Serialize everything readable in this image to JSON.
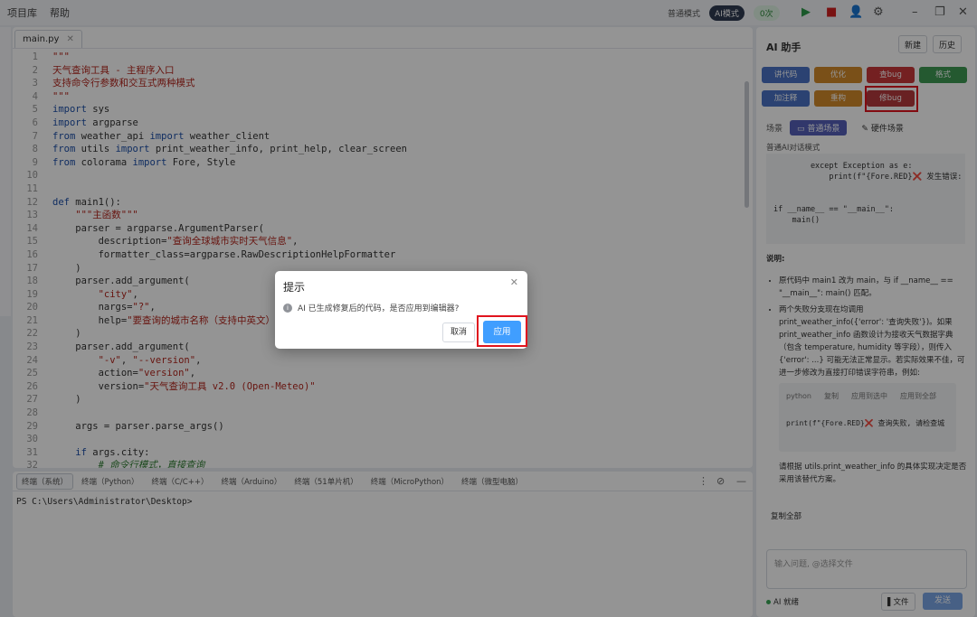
{
  "menu": [
    "项目库",
    "帮助"
  ],
  "toolbar": {
    "mode_normal": "普通模式",
    "mode_ai": "AI模式",
    "badge": "0次",
    "run_icon": "play-icon",
    "stop_icon": "stop-icon",
    "user_icon": "user-settings-icon",
    "settings_icon": "gear-icon"
  },
  "editor": {
    "file_tab": "main.py",
    "lines": [
      {
        "n": "1",
        "segs": [
          {
            "t": "\"\"\"",
            "c": "str"
          }
        ]
      },
      {
        "n": "2",
        "segs": [
          {
            "t": "天气查询工具 - 主程序入口",
            "c": "str"
          }
        ]
      },
      {
        "n": "3",
        "segs": [
          {
            "t": "支持命令行参数和交互式两种模式",
            "c": "str"
          }
        ]
      },
      {
        "n": "4",
        "segs": [
          {
            "t": "\"\"\"",
            "c": "str"
          }
        ]
      },
      {
        "n": "5",
        "segs": [
          {
            "t": "import",
            "c": "kw"
          },
          {
            "t": " sys",
            "c": ""
          }
        ]
      },
      {
        "n": "6",
        "segs": [
          {
            "t": "import",
            "c": "kw"
          },
          {
            "t": " argparse",
            "c": ""
          }
        ]
      },
      {
        "n": "7",
        "segs": [
          {
            "t": "from",
            "c": "kw"
          },
          {
            "t": " weather_api ",
            "c": ""
          },
          {
            "t": "import",
            "c": "kw"
          },
          {
            "t": " weather_client",
            "c": ""
          }
        ]
      },
      {
        "n": "8",
        "segs": [
          {
            "t": "from",
            "c": "kw"
          },
          {
            "t": " utils ",
            "c": ""
          },
          {
            "t": "import",
            "c": "kw"
          },
          {
            "t": " print_weather_info, print_help, clear_screen",
            "c": ""
          }
        ]
      },
      {
        "n": "9",
        "segs": [
          {
            "t": "from",
            "c": "kw"
          },
          {
            "t": " colorama ",
            "c": ""
          },
          {
            "t": "import",
            "c": "kw"
          },
          {
            "t": " Fore, Style",
            "c": ""
          }
        ]
      },
      {
        "n": "10",
        "segs": []
      },
      {
        "n": "11",
        "segs": []
      },
      {
        "n": "12",
        "segs": [
          {
            "t": "def",
            "c": "kw"
          },
          {
            "t": " main1():",
            "c": ""
          }
        ]
      },
      {
        "n": "13",
        "segs": [
          {
            "t": "    \"\"\"主函数\"\"\"",
            "c": "str"
          }
        ]
      },
      {
        "n": "14",
        "segs": [
          {
            "t": "    parser = argparse.ArgumentParser(",
            "c": ""
          }
        ]
      },
      {
        "n": "15",
        "segs": [
          {
            "t": "        description=",
            "c": ""
          },
          {
            "t": "\"查询全球城市实时天气信息\"",
            "c": "str"
          },
          {
            "t": ",",
            "c": ""
          }
        ]
      },
      {
        "n": "16",
        "segs": [
          {
            "t": "        formatter_class=argparse.RawDescriptionHelpFormatter",
            "c": ""
          }
        ]
      },
      {
        "n": "17",
        "segs": [
          {
            "t": "    )",
            "c": ""
          }
        ]
      },
      {
        "n": "18",
        "segs": [
          {
            "t": "    parser.add_argument(",
            "c": ""
          }
        ]
      },
      {
        "n": "19",
        "segs": [
          {
            "t": "        ",
            "c": ""
          },
          {
            "t": "\"city\"",
            "c": "str"
          },
          {
            "t": ",",
            "c": ""
          }
        ]
      },
      {
        "n": "20",
        "segs": [
          {
            "t": "        nargs=",
            "c": ""
          },
          {
            "t": "\"?\"",
            "c": "str"
          },
          {
            "t": ",",
            "c": ""
          }
        ]
      },
      {
        "n": "21",
        "segs": [
          {
            "t": "        help=",
            "c": ""
          },
          {
            "t": "\"要查询的城市名称（支持中英文）\"",
            "c": "str"
          }
        ]
      },
      {
        "n": "22",
        "segs": [
          {
            "t": "    )",
            "c": ""
          }
        ]
      },
      {
        "n": "23",
        "segs": [
          {
            "t": "    parser.add_argument(",
            "c": ""
          }
        ]
      },
      {
        "n": "24",
        "segs": [
          {
            "t": "        ",
            "c": ""
          },
          {
            "t": "\"-v\"",
            "c": "str"
          },
          {
            "t": ", ",
            "c": ""
          },
          {
            "t": "\"--version\"",
            "c": "str"
          },
          {
            "t": ",",
            "c": ""
          }
        ]
      },
      {
        "n": "25",
        "segs": [
          {
            "t": "        action=",
            "c": ""
          },
          {
            "t": "\"version\"",
            "c": "str"
          },
          {
            "t": ",",
            "c": ""
          }
        ]
      },
      {
        "n": "26",
        "segs": [
          {
            "t": "        version=",
            "c": ""
          },
          {
            "t": "\"天气查询工具 v2.0 (Open-Meteo)\"",
            "c": "str"
          }
        ]
      },
      {
        "n": "27",
        "segs": [
          {
            "t": "    )",
            "c": ""
          }
        ]
      },
      {
        "n": "28",
        "segs": []
      },
      {
        "n": "29",
        "segs": [
          {
            "t": "    args = parser.parse_args()",
            "c": ""
          }
        ]
      },
      {
        "n": "30",
        "segs": []
      },
      {
        "n": "31",
        "segs": [
          {
            "t": "    ",
            "c": ""
          },
          {
            "t": "if",
            "c": "kw"
          },
          {
            "t": " args.city:",
            "c": ""
          }
        ]
      },
      {
        "n": "32",
        "segs": [
          {
            "t": "        # 命令行模式，直接查询",
            "c": "com"
          }
        ]
      }
    ]
  },
  "terminal": {
    "tabs": [
      "终端（系统）",
      "终端（Python）",
      "终端（C/C++）",
      "终端（Arduino）",
      "终端（51单片机）",
      "终端（MicroPython）",
      "终端（微型电脑）"
    ],
    "prompt": "PS C:\\Users\\Administrator\\Desktop>"
  },
  "ai_panel": {
    "title": "AI 助手",
    "new_btn": "新建",
    "history_btn": "历史",
    "actions": [
      {
        "label": "讲代码",
        "color": "#4a72c4"
      },
      {
        "label": "优化",
        "color": "#d28a2a"
      },
      {
        "label": "查bug",
        "color": "#c8373a"
      },
      {
        "label": "格式",
        "color": "#3e9a54"
      },
      {
        "label": "加注释",
        "color": "#4a72c4"
      },
      {
        "label": "重构",
        "color": "#d28a2a"
      },
      {
        "label": "修bug",
        "color": "#b53a3d"
      }
    ],
    "scene_label": "场景",
    "scene_normal": "普通场景",
    "scene_hardware": "硬件场景",
    "mode_text": "普通AI对话模式",
    "code_snippet": "        except Exception as e:\n            print(f\"{Fore.RED}❌ 发生错误: \n\n\nif __name__ == \"__main__\":\n    main()",
    "explain_title": "说明:",
    "bullet1": "原代码中 main1 改为 main，与 if __name__ == \"__main__\": main() 匹配。",
    "bullet2": "两个失败分支现在均调用 print_weather_info({'error': '查询失败'})。如果 print_weather_info 函数设计为接收天气数据字典（包含 temperature, humidity 等字段），则传入 {'error': ...} 可能无法正常显示。若实际效果不佳，可进一步修改为直接打印错误字符串，例如:",
    "inner_tabs": [
      "python",
      "复制",
      "应用到选中",
      "应用到全部"
    ],
    "inner_code": "print(f\"{Fore.RED}❌ 查询失败, 请检查城",
    "bottom_text": "请根据 utils.print_weather_info 的具体实现决定是否采用该替代方案。",
    "copy_all": "复制全部",
    "input_placeholder": "输入问题, @选择文件",
    "status": "AI 就绪",
    "file_btn": "▌文件",
    "send_btn": "发送"
  },
  "dialog": {
    "title": "提示",
    "message": "AI 已生成修复后的代码，是否应用到编辑器?",
    "cancel": "取消",
    "ok": "应用"
  }
}
